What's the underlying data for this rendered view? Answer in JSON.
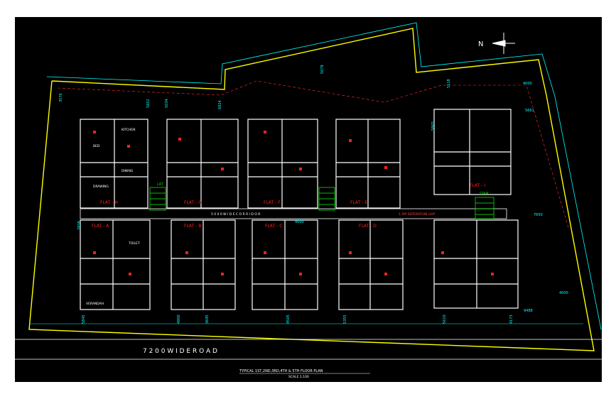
{
  "drawing": {
    "road_label": "7 2 0 0   W I D E   R O A D",
    "title_line1": "TYPICAL 1ST,2ND,3RD,4TH & 5TH FLOOR PLAN",
    "title_line2": "SCALE 1:100",
    "corridor_label": "5 0 0 0   W I D E   C O R R I D O R",
    "corridor_dim": "4000",
    "service_gap_label": "1.5M SEPERATION GAP",
    "north_label": "N"
  },
  "flat_labels": {
    "a": "FLAT - A",
    "b": "FLAT - B",
    "c": "FLAT - C",
    "d": "FLAT - D",
    "e": "FLAT - E",
    "f": "FLAT - F",
    "g": "FLAT - G",
    "h": "FLAT - H",
    "i": "FLAT - I"
  },
  "rooms": {
    "bed": "BED",
    "kitchen": "KITCHEN",
    "dining": "DINING",
    "drawing": "DRAWING",
    "toilet": "TOILET",
    "verandah": "VERANDAH",
    "lift": "LIFT",
    "stair": "STAIR"
  },
  "dimensions": {
    "d1": "3576",
    "d2": "5652",
    "d3": "5034",
    "d4": "6924",
    "d5": "5078",
    "d6": "5118",
    "d7": "4000",
    "d8": "5661",
    "d9": "7650",
    "d10": "4000",
    "d11": "9488",
    "d12": "4173",
    "d13": "5610",
    "d14": "5355",
    "d15": "4505",
    "d16": "3695",
    "d17": "4900",
    "d18": "5845",
    "d19": "7838",
    "d20": "5865"
  },
  "colors": {
    "boundary": "#ffff00",
    "wall": "#ffffff",
    "cyan": "#00ffff",
    "red": "#ff2020",
    "green": "#00ff00",
    "magenta": "#ff00ff",
    "blue": "#3050ff"
  }
}
